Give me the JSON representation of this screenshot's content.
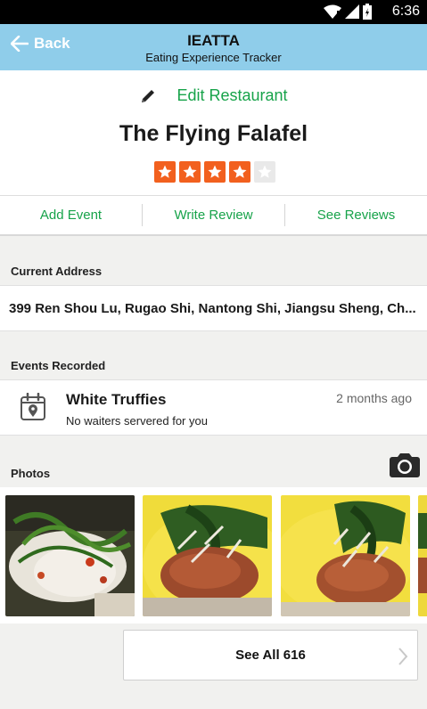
{
  "status_bar": {
    "time": "6:36"
  },
  "app_bar": {
    "back_label": "Back",
    "title": "IEATTA",
    "subtitle": "Eating Experience Tracker",
    "color": "#8fcdea"
  },
  "restaurant": {
    "edit_label": "Edit Restaurant",
    "name": "The Flying Falafel",
    "rating": 4,
    "rating_max": 5
  },
  "actions": {
    "add_event": "Add Event",
    "write_review": "Write Review",
    "see_reviews": "See Reviews"
  },
  "address_section": {
    "header": "Current Address",
    "value": "399 Ren Shou Lu, Rugao Shi, Nantong Shi, Jiangsu Sheng, Ch..."
  },
  "events_section": {
    "header": "Events Recorded",
    "items": [
      {
        "title": "White Truffies",
        "description": "No waiters servered for you",
        "time": "2 months ago"
      }
    ]
  },
  "photos_section": {
    "header": "Photos",
    "camera_icon": "camera-icon",
    "see_all_label": "See All 616"
  },
  "colors": {
    "accent_green": "#17a34a",
    "star_orange": "#f2601e"
  }
}
